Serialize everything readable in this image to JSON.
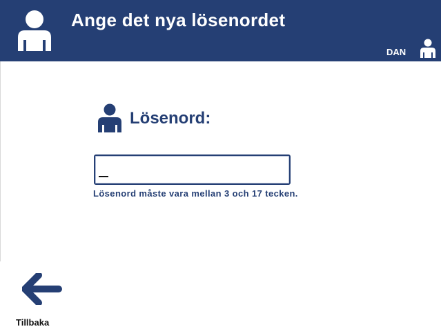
{
  "header": {
    "title": "Ange det nya lösenordet",
    "user": "DAN",
    "icon": "user-icon"
  },
  "form": {
    "label": "Lösenord:",
    "password_value": "",
    "hint": "Lösenord måste vara mellan 3 och 17 tecken."
  },
  "footer": {
    "back_label": "Tillbaka",
    "back_icon": "arrow-left-icon"
  },
  "colors": {
    "primary": "#253f74",
    "background": "#ffffff"
  }
}
